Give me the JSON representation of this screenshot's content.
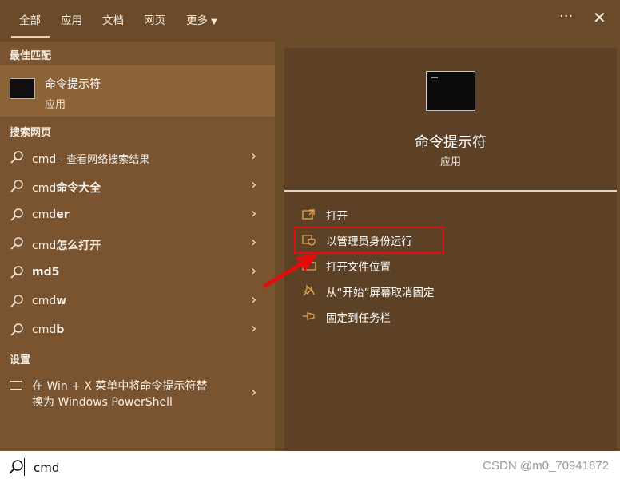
{
  "tabs": [
    "全部",
    "应用",
    "文档",
    "网页",
    "更多"
  ],
  "toolbar": {
    "more_icon": "ellipsis-icon",
    "close_icon": "close-icon"
  },
  "left": {
    "best_match_title": "最佳匹配",
    "best_match": {
      "name": "命令提示符",
      "type": "应用"
    },
    "web_title": "搜索网页",
    "web_results": [
      {
        "prefix": "cmd",
        "bold": "",
        "suffix": " - 查看网络搜索结果"
      },
      {
        "prefix": "cmd",
        "bold": "命令大全",
        "suffix": ""
      },
      {
        "prefix": "cmd",
        "bold": "er",
        "suffix": ""
      },
      {
        "prefix": "cmd",
        "bold": "怎么打开",
        "suffix": ""
      },
      {
        "prefix": "",
        "bold": "md5",
        "suffix": ""
      },
      {
        "prefix": "cmd",
        "bold": "w",
        "suffix": ""
      },
      {
        "prefix": "cmd",
        "bold": "b",
        "suffix": ""
      }
    ],
    "settings_title": "设置",
    "settings_item": {
      "line1": "在 Win + X 菜单中将命令提示符替",
      "line2": "换为 Windows PowerShell"
    }
  },
  "right": {
    "app_name": "命令提示符",
    "app_type": "应用",
    "actions": [
      "打开",
      "以管理员身份运行",
      "打开文件位置",
      "从“开始”屏幕取消固定",
      "固定到任务栏"
    ]
  },
  "search": {
    "value": "cmd"
  },
  "watermark": "CSDN @m0_70941872",
  "colors": {
    "accent_orange": "#e8a54a",
    "highlight_red": "#e30d0d"
  }
}
